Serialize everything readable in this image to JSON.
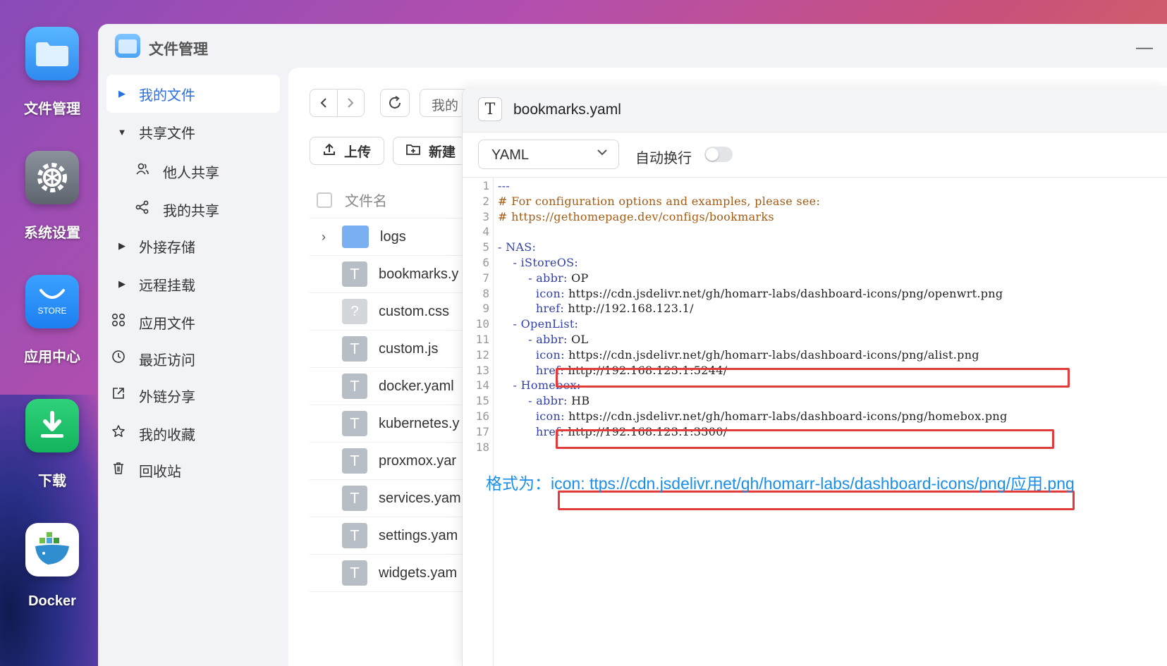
{
  "dock": [
    {
      "label": "文件管理",
      "icon": "folder-icon"
    },
    {
      "label": "系统设置",
      "icon": "gear-icon"
    },
    {
      "label": "应用中心",
      "icon": "store-icon",
      "badge": "STORE"
    },
    {
      "label": "下载",
      "icon": "download-icon"
    },
    {
      "label": "Docker",
      "icon": "docker-icon"
    }
  ],
  "window": {
    "title": "文件管理",
    "minimize": "—"
  },
  "sidebar": {
    "items": [
      {
        "label": "我的文件",
        "arrow": "▶",
        "active": true
      },
      {
        "label": "共享文件",
        "arrow": "▼"
      },
      {
        "label": "他人共享",
        "icon": "users-icon"
      },
      {
        "label": "我的共享",
        "icon": "share-icon"
      },
      {
        "label": "外接存储",
        "arrow": "▶"
      },
      {
        "label": "远程挂载",
        "arrow": "▶"
      },
      {
        "label": "应用文件",
        "icon": "apps-icon"
      },
      {
        "label": "最近访问",
        "icon": "clock-icon"
      },
      {
        "label": "外链分享",
        "icon": "external-link-icon"
      },
      {
        "label": "我的收藏",
        "icon": "star-icon"
      },
      {
        "label": "回收站",
        "icon": "trash-icon"
      }
    ]
  },
  "filepane": {
    "path": "我的",
    "upload_label": "上传",
    "new_label": "新建",
    "header": "文件名",
    "files": [
      {
        "name": "logs",
        "type": "folder"
      },
      {
        "name": "bookmarks.y",
        "type": "text"
      },
      {
        "name": "custom.css",
        "type": "unknown"
      },
      {
        "name": "custom.js",
        "type": "text"
      },
      {
        "name": "docker.yaml",
        "type": "text"
      },
      {
        "name": "kubernetes.y",
        "type": "text"
      },
      {
        "name": "proxmox.yar",
        "type": "text"
      },
      {
        "name": "services.yam",
        "type": "text"
      },
      {
        "name": "settings.yam",
        "type": "text"
      },
      {
        "name": "widgets.yam",
        "type": "text"
      }
    ]
  },
  "editor": {
    "title": "bookmarks.yaml",
    "language": "YAML",
    "wrap_label": "自动换行",
    "wrap_enabled": false,
    "lines": [
      "---",
      "# For configuration options and examples, please see:",
      "# https://gethomepage.dev/configs/bookmarks",
      "",
      "- NAS:",
      "    - iStoreOS:",
      "        - abbr: OP",
      "          icon: https://cdn.jsdelivr.net/gh/homarr-labs/dashboard-icons/png/openwrt.png",
      "          href: http://192.168.123.1/",
      "    - OpenList:",
      "        - abbr: OL",
      "          icon: https://cdn.jsdelivr.net/gh/homarr-labs/dashboard-icons/png/alist.png",
      "          href: http://192.168.123.1:5244/",
      "    - Homebox:",
      "        - abbr: HB",
      "          icon: https://cdn.jsdelivr.net/gh/homarr-labs/dashboard-icons/png/homebox.png",
      "          href: http://192.168.123.1:3300/",
      ""
    ],
    "note": "格式为：icon: ttps://cdn.jsdelivr.net/gh/homarr-labs/dashboard-icons/png/应用.png"
  },
  "colors": {
    "accent": "#2a6fe0",
    "highlight": "#e23b3b",
    "note": "#1a8ee8"
  }
}
